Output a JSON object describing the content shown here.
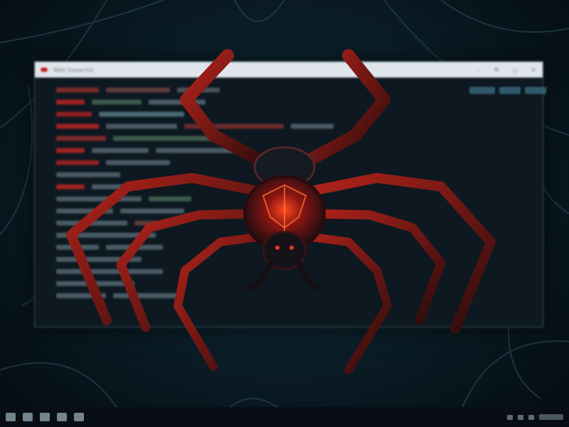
{
  "window": {
    "title": "Web Inspector",
    "controls": [
      "–",
      "⧉",
      "▢",
      "✕"
    ]
  },
  "taskbar": {
    "pinned_icons": [
      "start-icon",
      "search-icon",
      "explorer-icon",
      "mail-icon",
      "terminal-icon"
    ],
    "tray_icons": [
      "wifi-icon",
      "sound-icon",
      "battery-icon"
    ]
  },
  "colors": {
    "accent": "#c42020",
    "spider_body": "#1a0d10",
    "glow": "#ff3b1f"
  }
}
